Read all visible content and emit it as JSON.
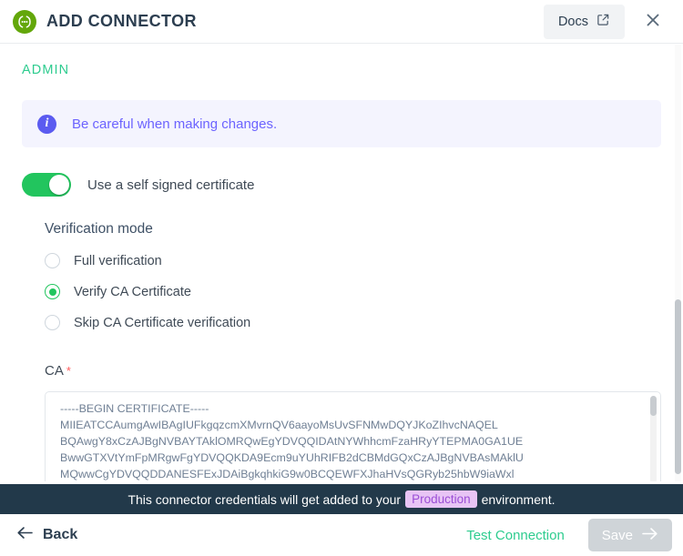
{
  "header": {
    "title": "ADD CONNECTOR",
    "brand_icon": "connector-icon",
    "docs_label": "Docs",
    "docs_icon": "external-link-icon",
    "close_icon": "close-icon",
    "brand_color": "#63a70a"
  },
  "section": {
    "label": "ADMIN",
    "label_color": "#2ecc8f"
  },
  "info_banner": {
    "icon": "info-icon",
    "text": "Be careful when making changes.",
    "text_color": "#6c63ff",
    "background": "#f4f4fe"
  },
  "self_signed_toggle": {
    "label": "Use a self signed certificate",
    "state": "on",
    "on_color": "#22c55e"
  },
  "verification_mode": {
    "title": "Verification mode",
    "selected": "Verify CA Certificate",
    "options": [
      {
        "label": "Full verification",
        "checked": false
      },
      {
        "label": "Verify CA Certificate",
        "checked": true
      },
      {
        "label": "Skip CA Certificate verification",
        "checked": false
      }
    ]
  },
  "ca_field": {
    "label": "CA",
    "required_marker": "*",
    "value": "-----BEGIN CERTIFICATE-----\nMIIEATCCAumgAwIBAgIUFkgqzcmXMvrnQV6aayoMsUvSFNMwDQYJKoZIhvcNAQEL\nBQAwgY8xCzAJBgNVBAYTAklOMRQwEgYDVQQIDAtNYWhhcmFzaHRyYTEPMA0GA1UE\nBwwGTXVtYmFpMRgwFgYDVQQKDA9Ecm9uYUhRIFB2dCBMdGQxCzAJBgNVBAsMAklU\nMQwwCgYDVQQDDANESFExJDAiBgkqhkiG9w0BCQEWFXJhaHVsQGRyb25hbW9iaWxl"
  },
  "environment_bar": {
    "prefix": "This connector credentials will get added to your",
    "badge": "Production",
    "suffix": "environment.",
    "background": "#22394a",
    "badge_background": "#e8c4f5",
    "badge_color": "#9b4ed6"
  },
  "footer": {
    "back_label": "Back",
    "back_icon": "arrow-left-icon",
    "test_connection_label": "Test Connection",
    "test_connection_color": "#2ecc8f",
    "save_label": "Save",
    "save_icon": "arrow-right-icon",
    "save_enabled": false
  }
}
